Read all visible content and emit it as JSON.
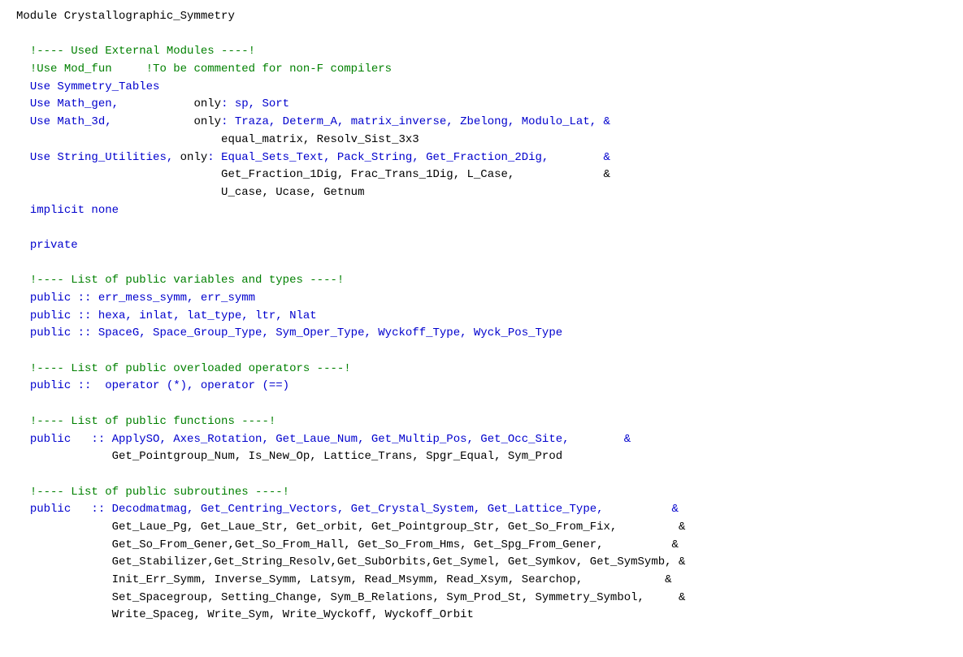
{
  "module": {
    "title": "Module Crystallographic_Symmetry",
    "sections": [
      {
        "id": "used-external-modules-comment",
        "type": "comment",
        "text": "!---- Used External Modules ----!"
      },
      {
        "id": "use-mod-fun-comment",
        "type": "comment-inline",
        "text": "!Use Mod_fun     !To be commented for non-F compilers"
      },
      {
        "id": "use-symmetry-tables",
        "type": "use",
        "text": "Use Symmetry_Tables"
      },
      {
        "id": "use-math-gen",
        "type": "use",
        "text": "Use Math_gen,           only: sp, Sort"
      },
      {
        "id": "use-math-3d-line1",
        "type": "use",
        "text": "Use Math_3d,            only: Traza, Determ_A, matrix_inverse, Zbelong, Modulo_Lat, &"
      },
      {
        "id": "use-math-3d-line2",
        "type": "continuation",
        "text": "                              equal_matrix, Resolv_Sist_3x3"
      },
      {
        "id": "use-string-utilities-line1",
        "type": "use",
        "text": "Use String_Utilities, only: Equal_Sets_Text, Pack_String, Get_Fraction_2Dig,        &"
      },
      {
        "id": "use-string-utilities-line2",
        "type": "continuation",
        "text": "                              Get_Fraction_1Dig, Frac_Trans_1Dig, L_Case,             &"
      },
      {
        "id": "use-string-utilities-line3",
        "type": "continuation",
        "text": "                              U_case, Ucase, Getnum"
      },
      {
        "id": "implicit-none",
        "type": "keyword",
        "text": "implicit none"
      },
      {
        "id": "private",
        "type": "keyword",
        "text": "private"
      },
      {
        "id": "public-vars-comment",
        "type": "comment",
        "text": "!---- List of public variables and types ----!"
      },
      {
        "id": "public-vars-line1",
        "type": "public",
        "text": "public :: err_mess_symm, err_symm"
      },
      {
        "id": "public-vars-line2",
        "type": "public",
        "text": "public :: hexa, inlat, lat_type, ltr, Nlat"
      },
      {
        "id": "public-vars-line3",
        "type": "public",
        "text": "public :: SpaceG, Space_Group_Type, Sym_Oper_Type, Wyckoff_Type, Wyck_Pos_Type"
      },
      {
        "id": "public-operators-comment",
        "type": "comment",
        "text": "!---- List of public overloaded operators ----!"
      },
      {
        "id": "public-operators",
        "type": "public",
        "text": "public ::  operator (*), operator (==)"
      },
      {
        "id": "public-functions-comment",
        "type": "comment",
        "text": "!---- List of public functions ----!"
      },
      {
        "id": "public-functions-line1",
        "type": "public",
        "text": "public   :: ApplySO, Axes_Rotation, Get_Laue_Num, Get_Multip_Pos, Get_Occ_Site,        &"
      },
      {
        "id": "public-functions-line2",
        "type": "continuation",
        "text": "            Get_Pointgroup_Num, Is_New_Op, Lattice_Trans, Spgr_Equal, Sym_Prod"
      },
      {
        "id": "public-subroutines-comment",
        "type": "comment",
        "text": "!---- List of public subroutines ----!"
      },
      {
        "id": "public-subroutines-line1",
        "type": "public",
        "text": "public   :: Decodmatmag, Get_Centring_Vectors, Get_Crystal_System, Get_Lattice_Type,          &"
      },
      {
        "id": "public-subroutines-line2",
        "type": "continuation",
        "text": "            Get_Laue_Pg, Get_Laue_Str, Get_orbit, Get_Pointgroup_Str, Get_So_From_Fix,         &"
      },
      {
        "id": "public-subroutines-line3",
        "type": "continuation",
        "text": "            Get_So_From_Gener,Get_So_From_Hall, Get_So_From_Hms, Get_Spg_From_Gener,          &"
      },
      {
        "id": "public-subroutines-line4",
        "type": "continuation",
        "text": "            Get_Stabilizer,Get_String_Resolv,Get_SubOrbits,Get_Symel, Get_Symkov, Get_SymSymb, &"
      },
      {
        "id": "public-subroutines-line5",
        "type": "continuation",
        "text": "            Init_Err_Symm, Inverse_Symm, Latsym, Read_Msymm, Read_Xsym, Searchop,            &"
      },
      {
        "id": "public-subroutines-line6",
        "type": "continuation",
        "text": "            Set_Spacegroup, Setting_Change, Sym_B_Relations, Sym_Prod_St, Symmetry_Symbol,     &"
      },
      {
        "id": "public-subroutines-line7",
        "type": "continuation",
        "text": "            Write_Spaceg, Write_Sym, Write_Wyckoff, Wyckoff_Orbit"
      }
    ]
  }
}
